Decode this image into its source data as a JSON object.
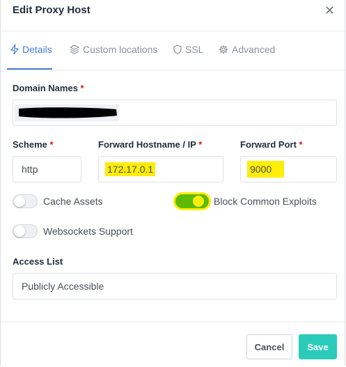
{
  "modal": {
    "title": "Edit Proxy Host",
    "close_icon": "close-icon"
  },
  "tabs": [
    {
      "label": "Details",
      "icon": "bolt-icon",
      "active": true
    },
    {
      "label": "Custom locations",
      "icon": "layers-icon",
      "active": false
    },
    {
      "label": "SSL",
      "icon": "shield-icon",
      "active": false
    },
    {
      "label": "Advanced",
      "icon": "gear-icon",
      "active": false
    }
  ],
  "form": {
    "domain_names": {
      "label": "Domain Names",
      "required_mark": "*"
    },
    "scheme": {
      "label": "Scheme",
      "required_mark": "*",
      "value": "http"
    },
    "forward_host": {
      "label": "Forward Hostname / IP",
      "required_mark": "*",
      "value": "172.17.0.1"
    },
    "forward_port": {
      "label": "Forward Port",
      "required_mark": "*",
      "value": "9000"
    },
    "cache_assets": {
      "label": "Cache Assets",
      "enabled": false
    },
    "block_exploits": {
      "label": "Block Common Exploits",
      "enabled": true
    },
    "websockets": {
      "label": "Websockets Support",
      "enabled": false
    },
    "access_list": {
      "label": "Access List",
      "value": "Publicly Accessible"
    }
  },
  "footer": {
    "cancel_label": "Cancel",
    "save_label": "Save"
  },
  "colors": {
    "accent": "#467fcf",
    "save": "#2bcbba",
    "toggle_on": "#5eba00",
    "highlight": "#ffed0a",
    "required": "#cd201f"
  }
}
